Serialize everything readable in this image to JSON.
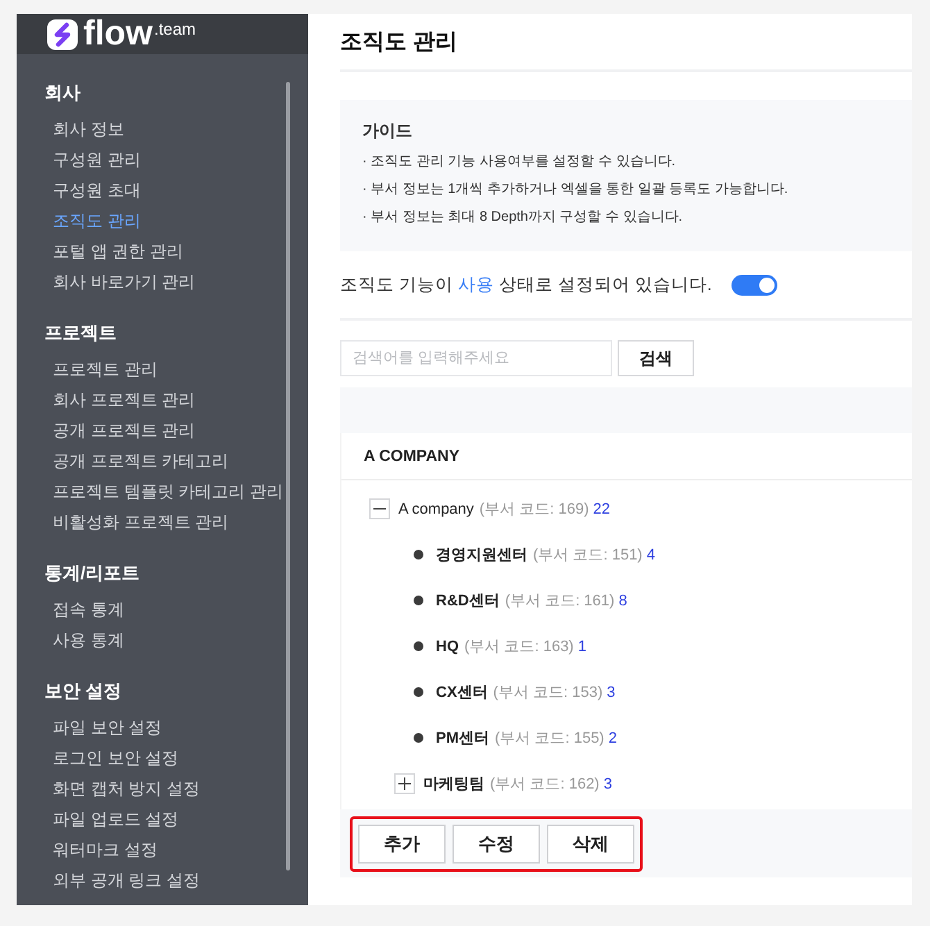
{
  "logo": {
    "word": "flow",
    "suffix": ".team"
  },
  "sidebar": {
    "sections": [
      {
        "title": "회사",
        "items": [
          {
            "label": "회사 정보",
            "selected": false
          },
          {
            "label": "구성원 관리",
            "selected": false
          },
          {
            "label": "구성원 초대",
            "selected": false
          },
          {
            "label": "조직도 관리",
            "selected": true
          },
          {
            "label": "포털 앱 권한 관리",
            "selected": false
          },
          {
            "label": "회사 바로가기 관리",
            "selected": false
          }
        ]
      },
      {
        "title": "프로젝트",
        "items": [
          {
            "label": "프로젝트 관리",
            "selected": false
          },
          {
            "label": "회사 프로젝트 관리",
            "selected": false
          },
          {
            "label": "공개 프로젝트 관리",
            "selected": false
          },
          {
            "label": "공개 프로젝트 카테고리",
            "selected": false
          },
          {
            "label": "프로젝트 템플릿 카테고리 관리",
            "selected": false
          },
          {
            "label": "비활성화 프로젝트 관리",
            "selected": false
          }
        ]
      },
      {
        "title": "통계/리포트",
        "items": [
          {
            "label": "접속 통계",
            "selected": false
          },
          {
            "label": "사용 통계",
            "selected": false
          }
        ]
      },
      {
        "title": "보안 설정",
        "items": [
          {
            "label": "파일 보안 설정",
            "selected": false
          },
          {
            "label": "로그인 보안 설정",
            "selected": false
          },
          {
            "label": "화면 캡처 방지 설정",
            "selected": false
          },
          {
            "label": "파일 업로드 설정",
            "selected": false
          },
          {
            "label": "워터마크 설정",
            "selected": false
          },
          {
            "label": "외부 공개 링크 설정",
            "selected": false
          }
        ]
      }
    ]
  },
  "page_title": "조직도 관리",
  "guide": {
    "title": "가이드",
    "lines": [
      "· 조직도 관리 기능 사용여부를 설정할 수 있습니다.",
      "· 부서 정보는 1개씩 추가하거나 엑셀을 통한 일괄 등록도 가능합니다.",
      "· 부서 정보는 최대 8 Depth까지 구성할 수 있습니다."
    ]
  },
  "feature_status": {
    "text": "조직도 기능이 **사용** 상태로 설정되어 있습니다.",
    "on": true
  },
  "search": {
    "placeholder": "검색어를 입력해주세요",
    "button": "검색"
  },
  "tree": {
    "heading": "A COMPANY",
    "nodes": [
      {
        "kind": "group",
        "name": "A company",
        "code": "(부서 코드: 169)",
        "count": "22",
        "expanded": true,
        "children": [
          {
            "kind": "leaf",
            "name": "경영지원센터",
            "code": "(부서 코드: 151)",
            "count": "4"
          },
          {
            "kind": "leaf",
            "name": "R&D센터",
            "code": "(부서 코드: 161)",
            "count": "8"
          },
          {
            "kind": "leaf",
            "name": "HQ",
            "code": "(부서 코드: 163)",
            "count": "1"
          },
          {
            "kind": "leaf",
            "name": "CX센터",
            "code": "(부서 코드: 153)",
            "count": "3"
          },
          {
            "kind": "leaf",
            "name": "PM센터",
            "code": "(부서 코드: 155)",
            "count": "2"
          },
          {
            "kind": "group",
            "name": "마케팅팀",
            "code": "(부서 코드: 162)",
            "count": "3",
            "expanded": false
          }
        ]
      }
    ]
  },
  "actions": {
    "highlighted": true,
    "buttons": [
      "추가",
      "수정",
      "삭제"
    ]
  }
}
